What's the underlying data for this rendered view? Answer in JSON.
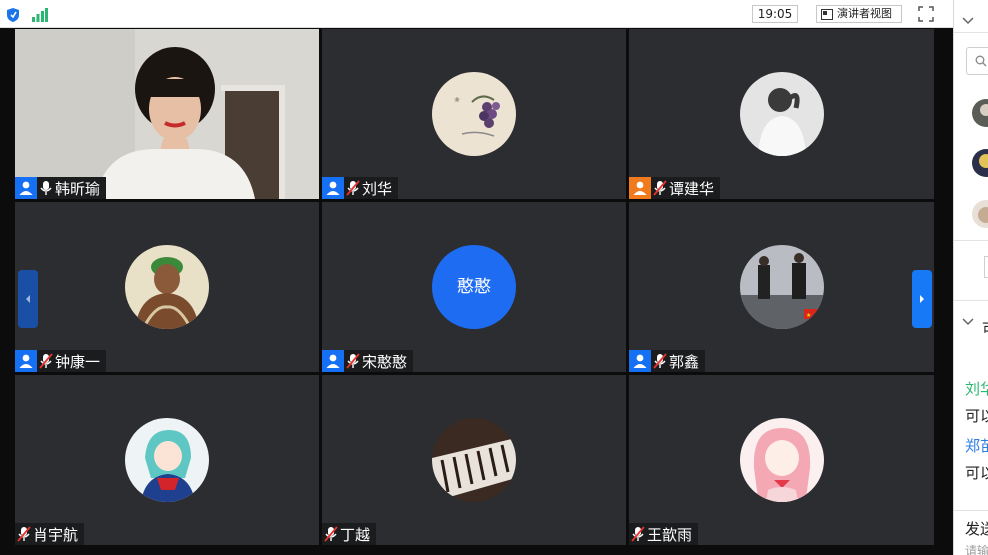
{
  "topbar": {
    "time": "19:05",
    "presenter_view_label": "演讲者视图"
  },
  "tiles": [
    {
      "name": "韩昕瑜",
      "badge": "host",
      "mic": "on",
      "video": true
    },
    {
      "name": "刘华",
      "badge": "host",
      "mic": "muted",
      "avatar": "grapes-painting"
    },
    {
      "name": "谭建华",
      "badge": "host-orange",
      "mic": "muted",
      "avatar": "person-photo"
    },
    {
      "name": "钟康一",
      "badge": "host",
      "mic": "muted",
      "avatar": "anime-character"
    },
    {
      "name": "宋憨憨",
      "badge": "host",
      "mic": "muted",
      "avatar_text": "憨憨"
    },
    {
      "name": "郭鑫",
      "badge": "host",
      "mic": "muted",
      "avatar": "street-photo"
    },
    {
      "name": "肖宇航",
      "badge": "none",
      "mic": "muted",
      "avatar": "anime-girl-blue"
    },
    {
      "name": "丁越",
      "badge": "none",
      "mic": "muted",
      "avatar": "piano-photo"
    },
    {
      "name": "王歆雨",
      "badge": "none",
      "mic": "muted",
      "avatar": "anime-girl-pink"
    }
  ],
  "side": {
    "chat_line1": "可以",
    "sender1": "刘华",
    "message1": "可以",
    "sender2": "郑苗",
    "message2": "可以",
    "send_label": "发送",
    "hint": "请输"
  },
  "colors": {
    "accent": "#1570f3",
    "tile_bg": "#2c2d30",
    "active_border": "#27c46c",
    "orange_badge": "#f07a1c"
  }
}
